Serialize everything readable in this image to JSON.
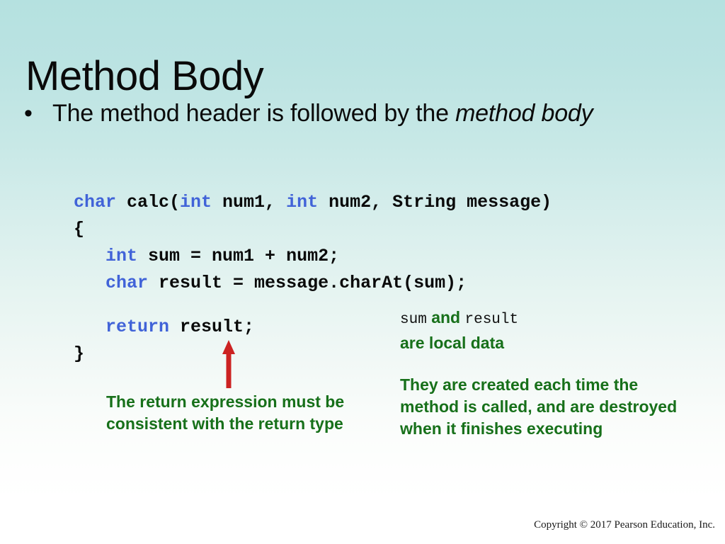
{
  "slide": {
    "title": "Method Body",
    "bullet_marker": "•",
    "bullet_text_before": "The method header is followed by the ",
    "bullet_text_emphasis": "method body"
  },
  "code": {
    "language": "Java",
    "keyword_color": "#4163d8",
    "text_color": "#0a0a0a",
    "lines": [
      [
        {
          "t": "char",
          "k": true
        },
        {
          "t": " calc(",
          "k": false
        },
        {
          "t": "int",
          "k": true
        },
        {
          "t": " num1, ",
          "k": false
        },
        {
          "t": "int",
          "k": true
        },
        {
          "t": " num2, String message)",
          "k": false
        }
      ],
      [
        {
          "t": "{",
          "k": false
        }
      ],
      [
        {
          "t": "   ",
          "k": false
        },
        {
          "t": "int",
          "k": true
        },
        {
          "t": " sum = num1 + num2;",
          "k": false
        }
      ],
      [
        {
          "t": "   ",
          "k": false
        },
        {
          "t": "char",
          "k": true
        },
        {
          "t": " result = message.charAt(sum);",
          "k": false
        }
      ],
      [],
      [
        {
          "t": "   ",
          "k": false
        },
        {
          "t": "return",
          "k": true
        },
        {
          "t": " result;",
          "k": false
        }
      ],
      [
        {
          "t": "}",
          "k": false
        }
      ]
    ]
  },
  "annotations": {
    "arrow_color": "#cc2222",
    "green_color": "#17701a",
    "return_note": "The return expression must be consistent with the return type",
    "locals_note": {
      "var1": "sum",
      "conjunction": " and ",
      "var2": "result",
      "tail": "are local data"
    },
    "lifecycle_note": "They are created each time the method is called, and are destroyed when it finishes executing"
  },
  "footer": {
    "copyright": "Copyright © 2017 Pearson Education, Inc."
  }
}
